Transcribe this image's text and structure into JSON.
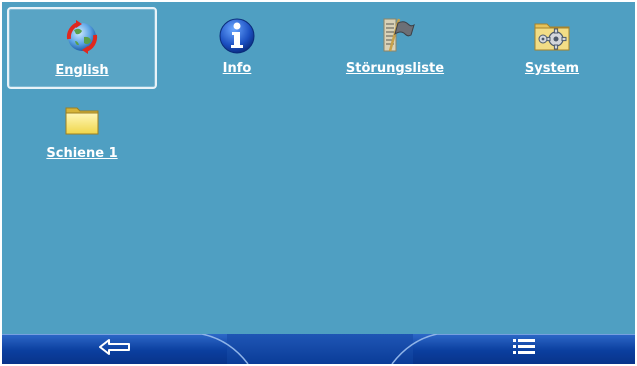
{
  "desktop": {
    "background": "#4f9fc2",
    "items": [
      {
        "label": "English",
        "icon": "globe-arrows-icon",
        "selected": true
      },
      {
        "label": "Info",
        "icon": "info-icon",
        "selected": false
      },
      {
        "label": "Störungsliste",
        "icon": "flag-list-icon",
        "selected": false
      },
      {
        "label": "System",
        "icon": "folder-gear-icon",
        "selected": false
      },
      {
        "label": "Schiene 1",
        "icon": "folder-icon",
        "selected": false
      }
    ]
  },
  "taskbar": {
    "back_icon": "back-arrow-icon",
    "menu_icon": "menu-list-icon",
    "color": "#0b3f9f"
  }
}
